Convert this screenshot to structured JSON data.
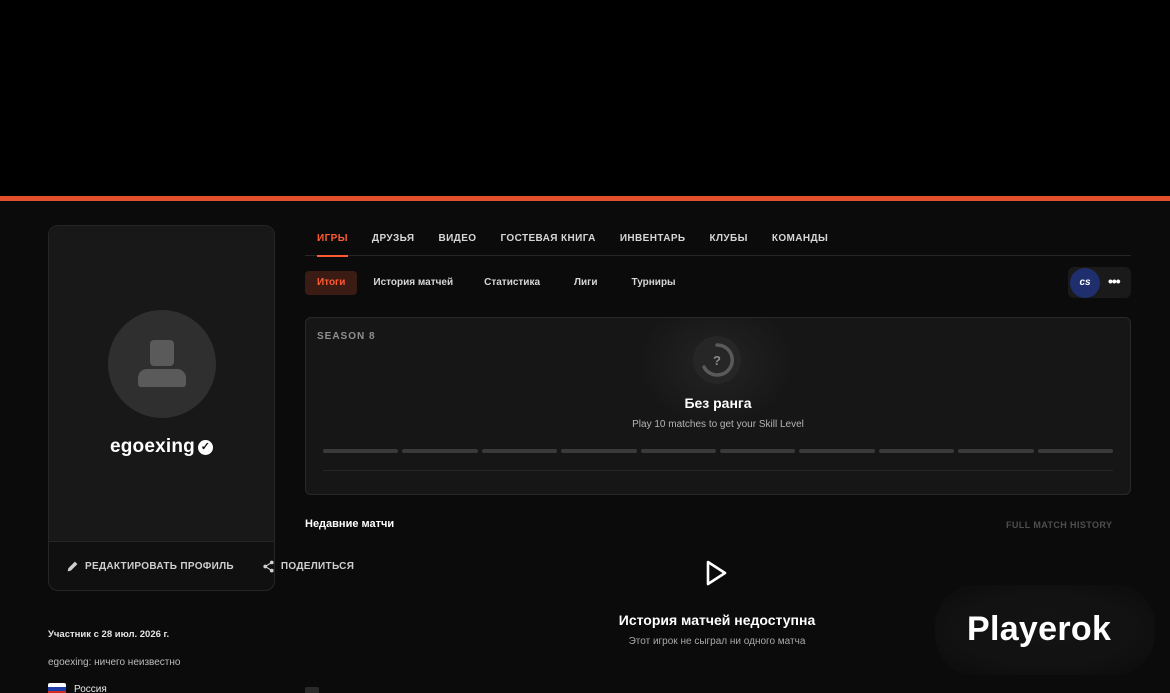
{
  "profile": {
    "username": "egoexing",
    "edit_label": "РЕДАКТИРОВАТЬ ПРОФИЛЬ",
    "share_label": "ПОДЕЛИТЬСЯ",
    "member_since": "Участник с 28 июл. 2026 г.",
    "bio": "egoexing: ничего неизвестно",
    "country": "Россия"
  },
  "main_tabs": [
    {
      "label": "ИГРЫ",
      "active": true
    },
    {
      "label": "ДРУЗЬЯ"
    },
    {
      "label": "ВИДЕО"
    },
    {
      "label": "ГОСТЕВАЯ КНИГА"
    },
    {
      "label": "ИНВЕНТАРЬ"
    },
    {
      "label": "КЛУБЫ"
    },
    {
      "label": "КОМАНДЫ"
    }
  ],
  "sub_tabs": [
    {
      "label": "Итоги",
      "active": true
    },
    {
      "label": "История матчей"
    },
    {
      "label": "Статистика"
    },
    {
      "label": "Лиги"
    },
    {
      "label": "Турниры"
    }
  ],
  "game_switch": {
    "logo_text": "cs",
    "more_icon": "more-dots-icon"
  },
  "season": {
    "label": "SEASON 8",
    "rank_icon_text": "?",
    "rank_title": "Без ранга",
    "rank_subtitle": "Play 10 matches to get your Skill Level",
    "progress_segments": 10,
    "matches_played": 0
  },
  "recent": {
    "title": "Недавние матчи",
    "full_history": "FULL MATCH HISTORY",
    "empty_title": "История матчей недоступна",
    "empty_subtitle": "Этот игрок не сыграл ни одного матча"
  },
  "watermark": "Playerok",
  "colors": {
    "accent": "#ff5a33",
    "accent_line": "#e5502c",
    "background": "#0b0b0b",
    "game_logo": "#1f2f6e"
  }
}
